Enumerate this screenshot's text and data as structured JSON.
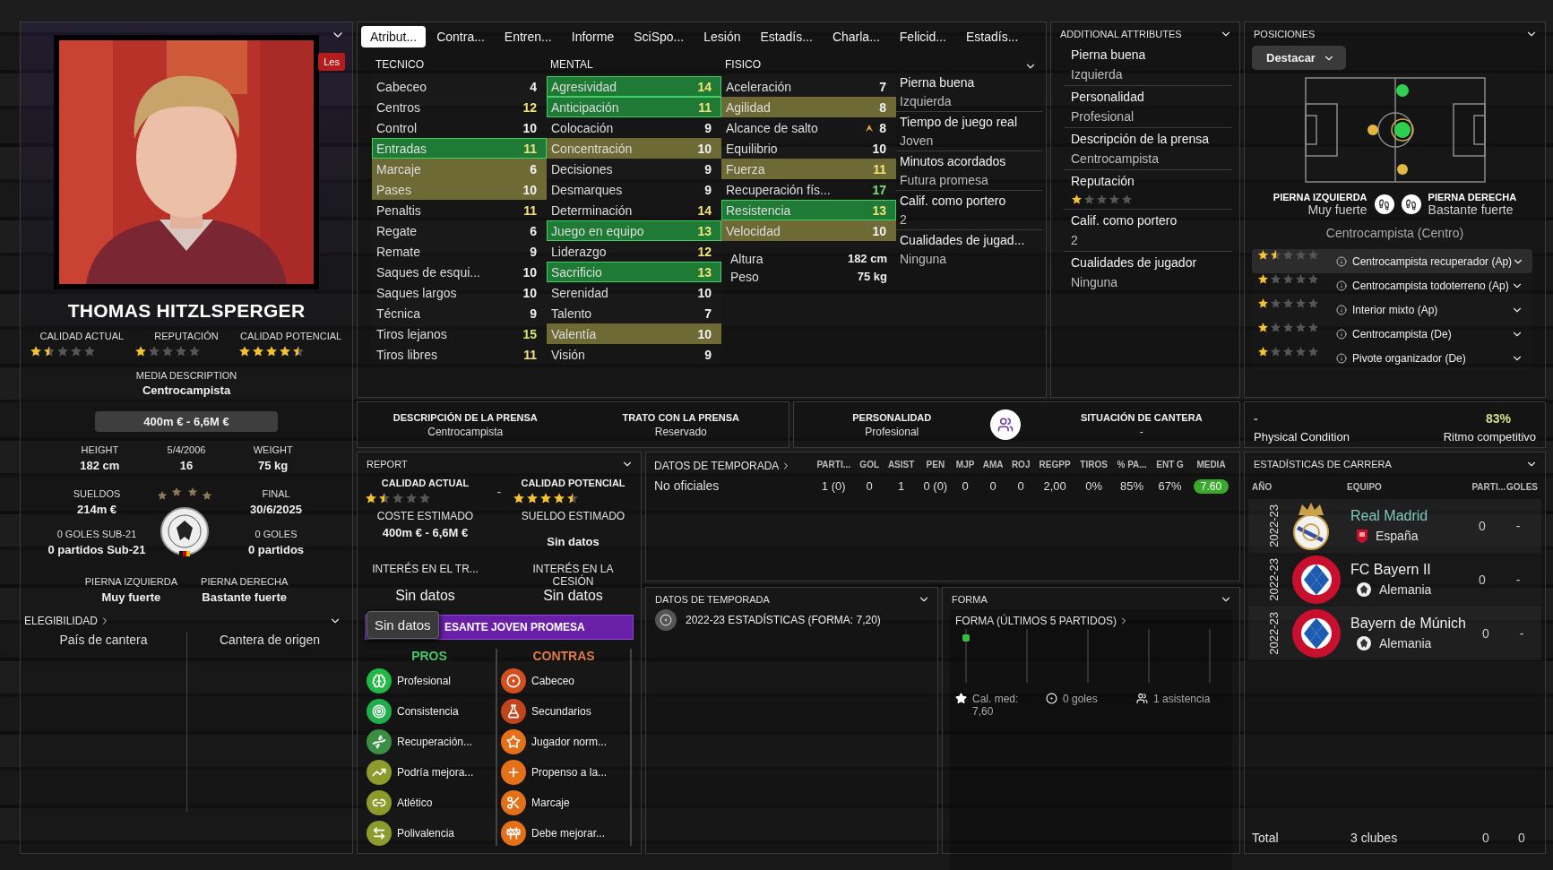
{
  "player": {
    "name": "THOMAS HITZLSPERGER",
    "badge": "Les",
    "ratings": [
      {
        "label": "CALIDAD ACTUAL",
        "stars": 1.5
      },
      {
        "label": "REPUTACIÓN",
        "stars": 1
      },
      {
        "label": "CALIDAD POTENCIAL",
        "stars": 4.5
      }
    ],
    "media_description": {
      "label": "MEDIA DESCRIPTION",
      "value": "Centrocampista"
    },
    "value_range": "400m € - 6,6M €",
    "bio": [
      {
        "label": "HEIGHT",
        "value": "182 cm"
      },
      {
        "label": "5/4/2006",
        "value": "16"
      },
      {
        "label": "WEIGHT",
        "value": "75 kg"
      }
    ],
    "contract_left": [
      {
        "label": "SUELDOS",
        "value": "214m €"
      },
      {
        "label": "0 GOLES SUB-21",
        "value": "0 partidos Sub-21"
      }
    ],
    "contract_right": [
      {
        "label": "FINAL",
        "value": "30/6/2025"
      },
      {
        "label": "0 GOLES",
        "value": "0 partidos"
      }
    ],
    "feet": [
      {
        "label": "PIERNA IZQUIERDA",
        "value": "Muy fuerte"
      },
      {
        "label": "PIERNA DERECHA",
        "value": "Bastante fuerte"
      }
    ],
    "eligibility": {
      "title": "ELEGIBILIDAD",
      "columns": [
        "País de cantera",
        "Cantera de origen"
      ]
    }
  },
  "tabs": [
    {
      "label": "Atribut...",
      "selected": true
    },
    {
      "label": "Contra...",
      "selected": false
    },
    {
      "label": "Entren...",
      "selected": false
    },
    {
      "label": "Informe",
      "selected": false
    },
    {
      "label": "SciSpo...",
      "selected": false
    },
    {
      "label": "Lesión",
      "selected": false
    },
    {
      "label": "Estadís...",
      "selected": false
    },
    {
      "label": "Charla...",
      "selected": false
    },
    {
      "label": "Felicid...",
      "selected": false
    },
    {
      "label": "Estadís...",
      "selected": false
    }
  ],
  "attributes": [
    {
      "title": "TECNICO",
      "items": [
        {
          "name": "Cabeceo",
          "value": "4",
          "kind": "plain",
          "arrow": false
        },
        {
          "name": "Centros",
          "value": "12",
          "kind": "plain",
          "arrow": false
        },
        {
          "name": "Control",
          "value": "10",
          "kind": "plain",
          "arrow": false
        },
        {
          "name": "Entradas",
          "value": "11",
          "kind": "strong",
          "arrow": false
        },
        {
          "name": "Marcaje",
          "value": "6",
          "kind": "key",
          "arrow": false
        },
        {
          "name": "Pases",
          "value": "10",
          "kind": "key",
          "arrow": false
        },
        {
          "name": "Penaltis",
          "value": "11",
          "kind": "plain",
          "arrow": false
        },
        {
          "name": "Regate",
          "value": "6",
          "kind": "plain",
          "arrow": false
        },
        {
          "name": "Remate",
          "value": "9",
          "kind": "plain",
          "arrow": false
        },
        {
          "name": "Saques de esqui...",
          "value": "10",
          "kind": "plain",
          "arrow": false
        },
        {
          "name": "Saques largos",
          "value": "10",
          "kind": "plain",
          "arrow": false
        },
        {
          "name": "Técnica",
          "value": "9",
          "kind": "plain",
          "arrow": false
        },
        {
          "name": "Tiros lejanos",
          "value": "15",
          "kind": "plain",
          "arrow": false
        },
        {
          "name": "Tiros libres",
          "value": "11",
          "kind": "plain",
          "arrow": false
        }
      ]
    },
    {
      "title": "MENTAL",
      "items": [
        {
          "name": "Agresividad",
          "value": "14",
          "kind": "strong",
          "arrow": false
        },
        {
          "name": "Anticipación",
          "value": "11",
          "kind": "strong",
          "arrow": false
        },
        {
          "name": "Colocación",
          "value": "9",
          "kind": "plain",
          "arrow": false
        },
        {
          "name": "Concentración",
          "value": "10",
          "kind": "key",
          "arrow": false
        },
        {
          "name": "Decisiones",
          "value": "9",
          "kind": "plain",
          "arrow": false
        },
        {
          "name": "Desmarques",
          "value": "9",
          "kind": "plain",
          "arrow": false
        },
        {
          "name": "Determinación",
          "value": "14",
          "kind": "plain",
          "arrow": false
        },
        {
          "name": "Juego en equipo",
          "value": "13",
          "kind": "strong",
          "arrow": false
        },
        {
          "name": "Liderazgo",
          "value": "12",
          "kind": "plain",
          "arrow": false
        },
        {
          "name": "Sacrificio",
          "value": "13",
          "kind": "strong",
          "arrow": false
        },
        {
          "name": "Serenidad",
          "value": "10",
          "kind": "plain",
          "arrow": false
        },
        {
          "name": "Talento",
          "value": "7",
          "kind": "plain",
          "arrow": false
        },
        {
          "name": "Valentía",
          "value": "10",
          "kind": "key",
          "arrow": false
        },
        {
          "name": "Visión",
          "value": "9",
          "kind": "plain",
          "arrow": false
        }
      ]
    },
    {
      "title": "FISICO",
      "items": [
        {
          "name": "Aceleración",
          "value": "7",
          "kind": "plain",
          "arrow": false
        },
        {
          "name": "Agilidad",
          "value": "8",
          "kind": "key",
          "arrow": false
        },
        {
          "name": "Alcance de salto",
          "value": "8",
          "kind": "plain",
          "arrow": true
        },
        {
          "name": "Equilibrio",
          "value": "10",
          "kind": "plain",
          "arrow": false
        },
        {
          "name": "Fuerza",
          "value": "11",
          "kind": "key",
          "arrow": false
        },
        {
          "name": "Recuperación fís...",
          "value": "17",
          "kind": "plain",
          "arrow": false
        },
        {
          "name": "Resistencia",
          "value": "13",
          "kind": "strong",
          "arrow": false
        },
        {
          "name": "Velocidad",
          "value": "10",
          "kind": "key",
          "arrow": false
        }
      ]
    }
  ],
  "physical_info": [
    {
      "label": "Altura",
      "value": "182 cm"
    },
    {
      "label": "Peso",
      "value": "75 kg"
    }
  ],
  "summary": [
    {
      "label": "Pierna buena",
      "value": "Izquierda"
    },
    {
      "label": "Tiempo de juego real",
      "value": "Joven"
    },
    {
      "label": "Minutos acordados",
      "value": "Futura promesa"
    },
    {
      "label": "Calif. como portero",
      "value": "2"
    },
    {
      "label": "Cualidades de jugad...",
      "value": "Ninguna"
    }
  ],
  "additional_attributes": {
    "title": "ADDITIONAL ATTRIBUTES",
    "items": [
      {
        "kind": "text",
        "label": "Pierna buena",
        "value": "Izquierda"
      },
      {
        "kind": "text",
        "label": "Personalidad",
        "value": "Profesional"
      },
      {
        "kind": "text",
        "label": "Descripción de la prensa",
        "value": "Centrocampista"
      },
      {
        "kind": "stars",
        "label": "Reputación",
        "stars": 1
      },
      {
        "kind": "text",
        "label": "Calif. como portero",
        "value": "2"
      },
      {
        "kind": "text",
        "label": "Cualidades de jugador",
        "value": "Ninguna"
      }
    ]
  },
  "positions": {
    "title": "POSICIONES",
    "filter": "Destacar",
    "feet": [
      {
        "label": "PIERNA IZQUIERDA",
        "value": "Muy fuerte"
      },
      {
        "label": "PIERNA DERECHA",
        "value": "Bastante fuerte"
      }
    ],
    "position": "Centrocampista (Centro)",
    "roles": [
      {
        "stars": 1.5,
        "name": "Centrocampista recuperador (Ap)",
        "selected": true
      },
      {
        "stars": 1,
        "name": "Centrocampista todoterreno (Ap)",
        "selected": false
      },
      {
        "stars": 1,
        "name": "Interior mixto (Ap)",
        "selected": false
      },
      {
        "stars": 1,
        "name": "Centrocampista (De)",
        "selected": false
      },
      {
        "stars": 1,
        "name": "Pivote organizador (De)",
        "selected": false
      }
    ]
  },
  "press": [
    {
      "label": "DESCRIPCIÓN DE LA PRENSA",
      "value": "Centrocampista"
    },
    {
      "label": "TRATO CON LA PRENSA",
      "value": "Reservado"
    }
  ],
  "personality": {
    "label": "PERSONALIDAD",
    "value": "Profesional"
  },
  "academy": {
    "label": "SITUACIÓN DE CANTERA",
    "value": "-"
  },
  "condition": {
    "value": "-",
    "label": "Physical Condition",
    "match_value": "83%",
    "match_label": "Ritmo competitivo"
  },
  "report": {
    "title": "REPORT",
    "ratings": [
      {
        "label": "CALIDAD ACTUAL",
        "stars": 1.5
      },
      {
        "label": "CALIDAD POTENCIAL",
        "stars": 4.5
      }
    ],
    "separator": "-",
    "fields": [
      {
        "label": "COSTE ESTIMADO",
        "value": "400m € - 6,6M €"
      },
      {
        "label": "SUELDO ESTIMADO",
        "value": "Sin datos"
      },
      {
        "label": "INTERÉS EN EL TR...",
        "value": "Sin datos"
      },
      {
        "label": "INTERÉS EN LA CESIÓN",
        "value": "Sin datos"
      }
    ],
    "banner": "ESANTE JOVEN PROMESA",
    "tooltip": "Sin datos",
    "pros": {
      "title": "PROS",
      "items": [
        {
          "kind": "head",
          "text": "Profesional",
          "color": "#22b845"
        },
        {
          "kind": "target",
          "text": "Consistencia",
          "color": "#1fae4a"
        },
        {
          "kind": "dna",
          "text": "Recuperación...",
          "color": "#3b8f45"
        },
        {
          "kind": "trend",
          "text": "Podría mejora...",
          "color": "#8d9a2c"
        },
        {
          "kind": "chain",
          "text": "Atlético",
          "color": "#8d9a2c"
        },
        {
          "kind": "arrows",
          "text": "Polivalencia",
          "color": "#8d9a2c"
        }
      ]
    },
    "cons": {
      "title": "CONTRAS",
      "items": [
        {
          "kind": "ball",
          "text": "Cabeceo",
          "color": "#d2501f"
        },
        {
          "kind": "flask",
          "text": "Secundarios",
          "color": "#c0441c"
        },
        {
          "kind": "star",
          "text": "Jugador norm...",
          "color": "#e4701a"
        },
        {
          "kind": "plus",
          "text": "Propenso a la...",
          "color": "#e4701a"
        },
        {
          "kind": "scissors",
          "text": "Marcaje",
          "color": "#e4701a"
        },
        {
          "kind": "cone",
          "text": "Debe mejorar...",
          "color": "#e4701a"
        }
      ]
    }
  },
  "season": {
    "title": "DATOS DE TEMPORADA",
    "columns": [
      "PARTI...",
      "GOL",
      "ASIST",
      "PEN",
      "MJP",
      "AMA",
      "ROJ",
      "REGPP",
      "TIROS",
      "% PA...",
      "ENT G",
      "MEDIA"
    ],
    "rows": [
      {
        "label": "No oficiales",
        "cells": [
          "1 (0)",
          "0",
          "1",
          "0 (0)",
          "0",
          "0",
          "0",
          "2,00",
          "0%",
          "85%",
          "67%"
        ],
        "rating": "7.60"
      }
    ]
  },
  "season_summary": {
    "title": "DATOS DE TEMPORADA",
    "entry": "2022-23 ESTADÍSTICAS (FORMA: 7,20)"
  },
  "form": {
    "title": "FORMA",
    "subtitle": "FORMA (ÚLTIMOS 5 PARTIDOS)",
    "stats": [
      {
        "kind": "star",
        "text": "Cal. med: 7,60"
      },
      {
        "kind": "ball",
        "text": "0 goles"
      },
      {
        "kind": "assist",
        "text": "1 asistencia"
      }
    ]
  },
  "career": {
    "title": "ESTADÍSTICAS DE CARRERA",
    "columns": [
      "AÑO",
      "EQUIPO",
      "PARTI...",
      "GOLES"
    ],
    "rows": [
      {
        "year": "2022-23",
        "team": "Real Madrid",
        "country": "España",
        "apps": "0",
        "goals": "-",
        "kind": "crown",
        "current": true
      },
      {
        "year": "2022-23",
        "team": "FC Bayern II",
        "country": "Alemania",
        "apps": "0",
        "goals": "-",
        "kind": "diamonds",
        "current": false
      },
      {
        "year": "2022-23",
        "team": "Bayern de Múnich",
        "country": "Alemania",
        "apps": "0",
        "goals": "-",
        "kind": "diamonds",
        "current": false
      }
    ],
    "total": {
      "label": "Total",
      "clubs": "3 clubes",
      "apps": "0",
      "goals": "0"
    }
  }
}
